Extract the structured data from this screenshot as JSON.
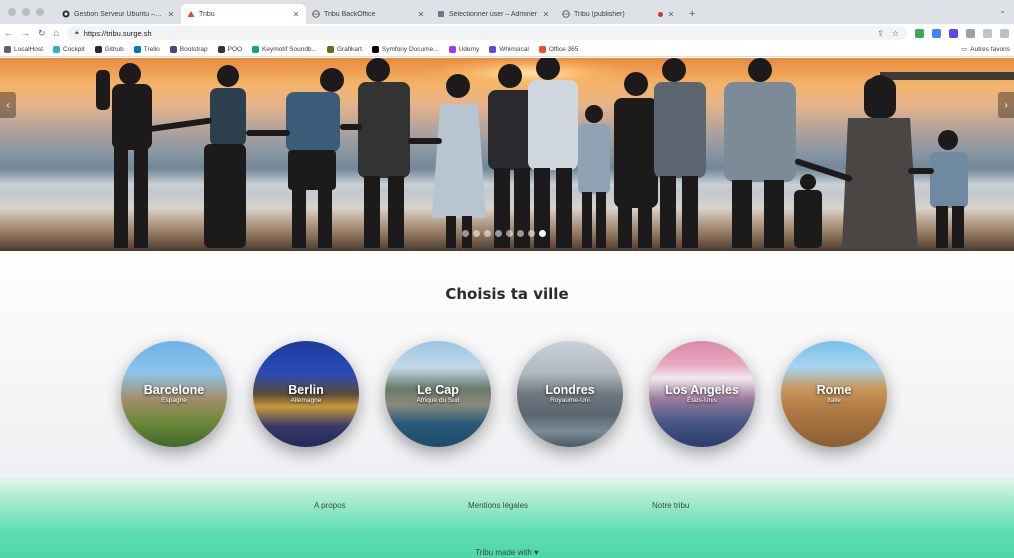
{
  "browser": {
    "tabs": [
      {
        "title": "Gestion Serveur Ubuntu – Koun",
        "active": false,
        "icon": "github-icon"
      },
      {
        "title": "Tribu",
        "active": true,
        "icon": "tribu-icon"
      },
      {
        "title": "Tribu BackOffice",
        "active": false,
        "icon": "globe-icon"
      },
      {
        "title": "Sélectionner user – Adminer",
        "active": false,
        "icon": "adminer-icon"
      },
      {
        "title": "Tribu (publisher)",
        "active": false,
        "icon": "globe-icon",
        "recording": true
      }
    ],
    "new_tab": "+",
    "url": "https://tribu.surge.sh",
    "bookmarks": [
      {
        "label": "LocalHost",
        "icon": "globe-icon",
        "color": "#5f6368"
      },
      {
        "label": "Cockpit",
        "icon": "cockpit-icon",
        "color": "#2bb0c9"
      },
      {
        "label": "Github",
        "icon": "github-icon",
        "color": "#24292e"
      },
      {
        "label": "Trello",
        "icon": "trello-icon",
        "color": "#0079bf"
      },
      {
        "label": "Bootstrap",
        "icon": "bootstrap-icon",
        "color": "#563d7c"
      },
      {
        "label": "POO",
        "icon": "book-icon",
        "color": "#333333"
      },
      {
        "label": "Keymotif Soundb...",
        "icon": "sound-icon",
        "color": "#16a085"
      },
      {
        "label": "Grafikart",
        "icon": "grafikart-icon",
        "color": "#6b6b1f"
      },
      {
        "label": "Symfony Docume...",
        "icon": "symfony-icon",
        "color": "#000000"
      },
      {
        "label": "Udemy",
        "icon": "udemy-icon",
        "color": "#a435f0"
      },
      {
        "label": "Whimsical",
        "icon": "whimsical-icon",
        "color": "#5b4ae8"
      },
      {
        "label": "Office 365",
        "icon": "office-icon",
        "color": "#f25022"
      }
    ],
    "other_bookmarks": "Autres favoris"
  },
  "hero": {
    "slide_count": 8,
    "active_slide": 8
  },
  "main": {
    "title": "Choisis ta ville",
    "cities": [
      {
        "name": "Barcelone",
        "country": "Espagne"
      },
      {
        "name": "Berlin",
        "country": "Allemagne"
      },
      {
        "name": "Le Cap",
        "country": "Afrique du Sud"
      },
      {
        "name": "Londres",
        "country": "Royaume-Uni"
      },
      {
        "name": "Los Angeles",
        "country": "États-Unis"
      },
      {
        "name": "Rome",
        "country": "Italie"
      }
    ]
  },
  "footer": {
    "links": [
      "A propos",
      "Mentions légales",
      "Notre tribu"
    ],
    "made_with": "Tribu made with ♥"
  },
  "colors": {
    "footer_accent": "#4fd6a9",
    "tab_bar": "#dee1e6"
  }
}
